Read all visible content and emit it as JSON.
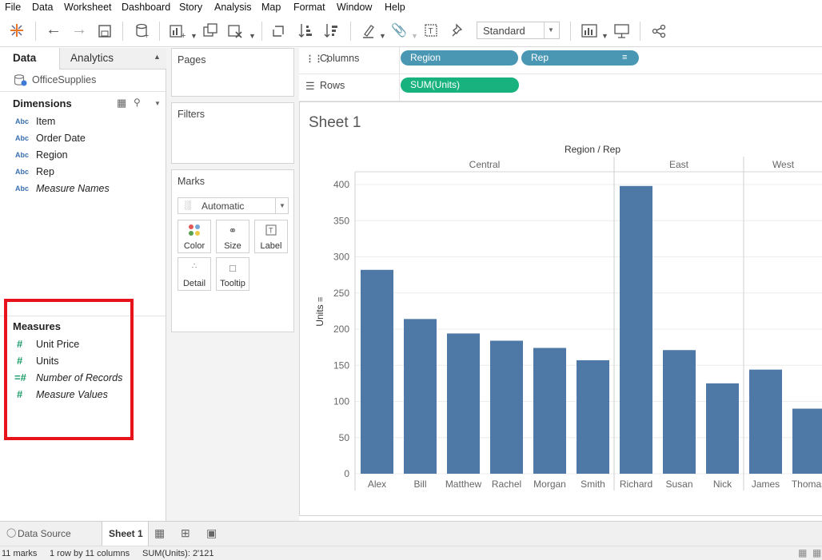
{
  "menu": [
    "File",
    "Data",
    "Worksheet",
    "Dashboard",
    "Story",
    "Analysis",
    "Map",
    "Format",
    "Window",
    "Help"
  ],
  "toolbar": {
    "fit_dropdown_value": "Standard"
  },
  "left_panel": {
    "tabs": {
      "data": "Data",
      "analytics": "Analytics"
    },
    "datasource": "OfficeSupplies",
    "dimensions_header": "Dimensions",
    "dimensions": [
      {
        "type": "Abc",
        "label": "Item"
      },
      {
        "type": "Abc",
        "label": "Order Date"
      },
      {
        "type": "Abc",
        "label": "Region"
      },
      {
        "type": "Abc",
        "label": "Rep"
      },
      {
        "type": "Abc",
        "label": "Measure Names"
      }
    ],
    "measures_header": "Measures",
    "measures": [
      {
        "type": "#",
        "label": "Unit Price"
      },
      {
        "type": "#",
        "label": "Units"
      },
      {
        "type": "=#",
        "label": "Number of Records"
      },
      {
        "type": "#",
        "label": "Measure Values"
      }
    ],
    "highlight_color": "#e8141c"
  },
  "shelves": {
    "pages": "Pages",
    "filters": "Filters",
    "marks": "Marks",
    "mark_type": "Automatic",
    "mark_buttons": [
      "Color",
      "Size",
      "Label",
      "Detail",
      "Tooltip"
    ],
    "columns_label": "Columns",
    "rows_label": "Rows",
    "column_pills": [
      "Region",
      "Rep"
    ],
    "row_pills": [
      "SUM(Units)"
    ],
    "dimension_pill_color": "#4a97b4",
    "measure_pill_color": "#17b27d"
  },
  "sheet": {
    "title": "Sheet 1"
  },
  "chart_data": {
    "type": "bar",
    "title": "Region / Rep",
    "ylabel": "Units",
    "ylim": [
      0,
      420
    ],
    "yticks": [
      0,
      50,
      100,
      150,
      200,
      250,
      300,
      350,
      400
    ],
    "groups": [
      {
        "name": "Central",
        "categories": [
          "Alex",
          "Bill",
          "Matthew",
          "Rachel",
          "Morgan",
          "Smith"
        ],
        "values": [
          282,
          214,
          194,
          184,
          174,
          157
        ]
      },
      {
        "name": "East",
        "categories": [
          "Richard",
          "Susan",
          "Nick"
        ],
        "values": [
          398,
          171,
          125
        ]
      },
      {
        "name": "West",
        "categories": [
          "James",
          "Thomas"
        ],
        "values": [
          144,
          90
        ]
      }
    ],
    "bar_color": "#4e79a7",
    "grid": true
  },
  "bottom_tabs": {
    "datasource": "Data Source",
    "sheet": "Sheet 1"
  },
  "status": {
    "marks": "11 marks",
    "rows_cols": "1 row by 11 columns",
    "sum": "SUM(Units): 2'121"
  }
}
